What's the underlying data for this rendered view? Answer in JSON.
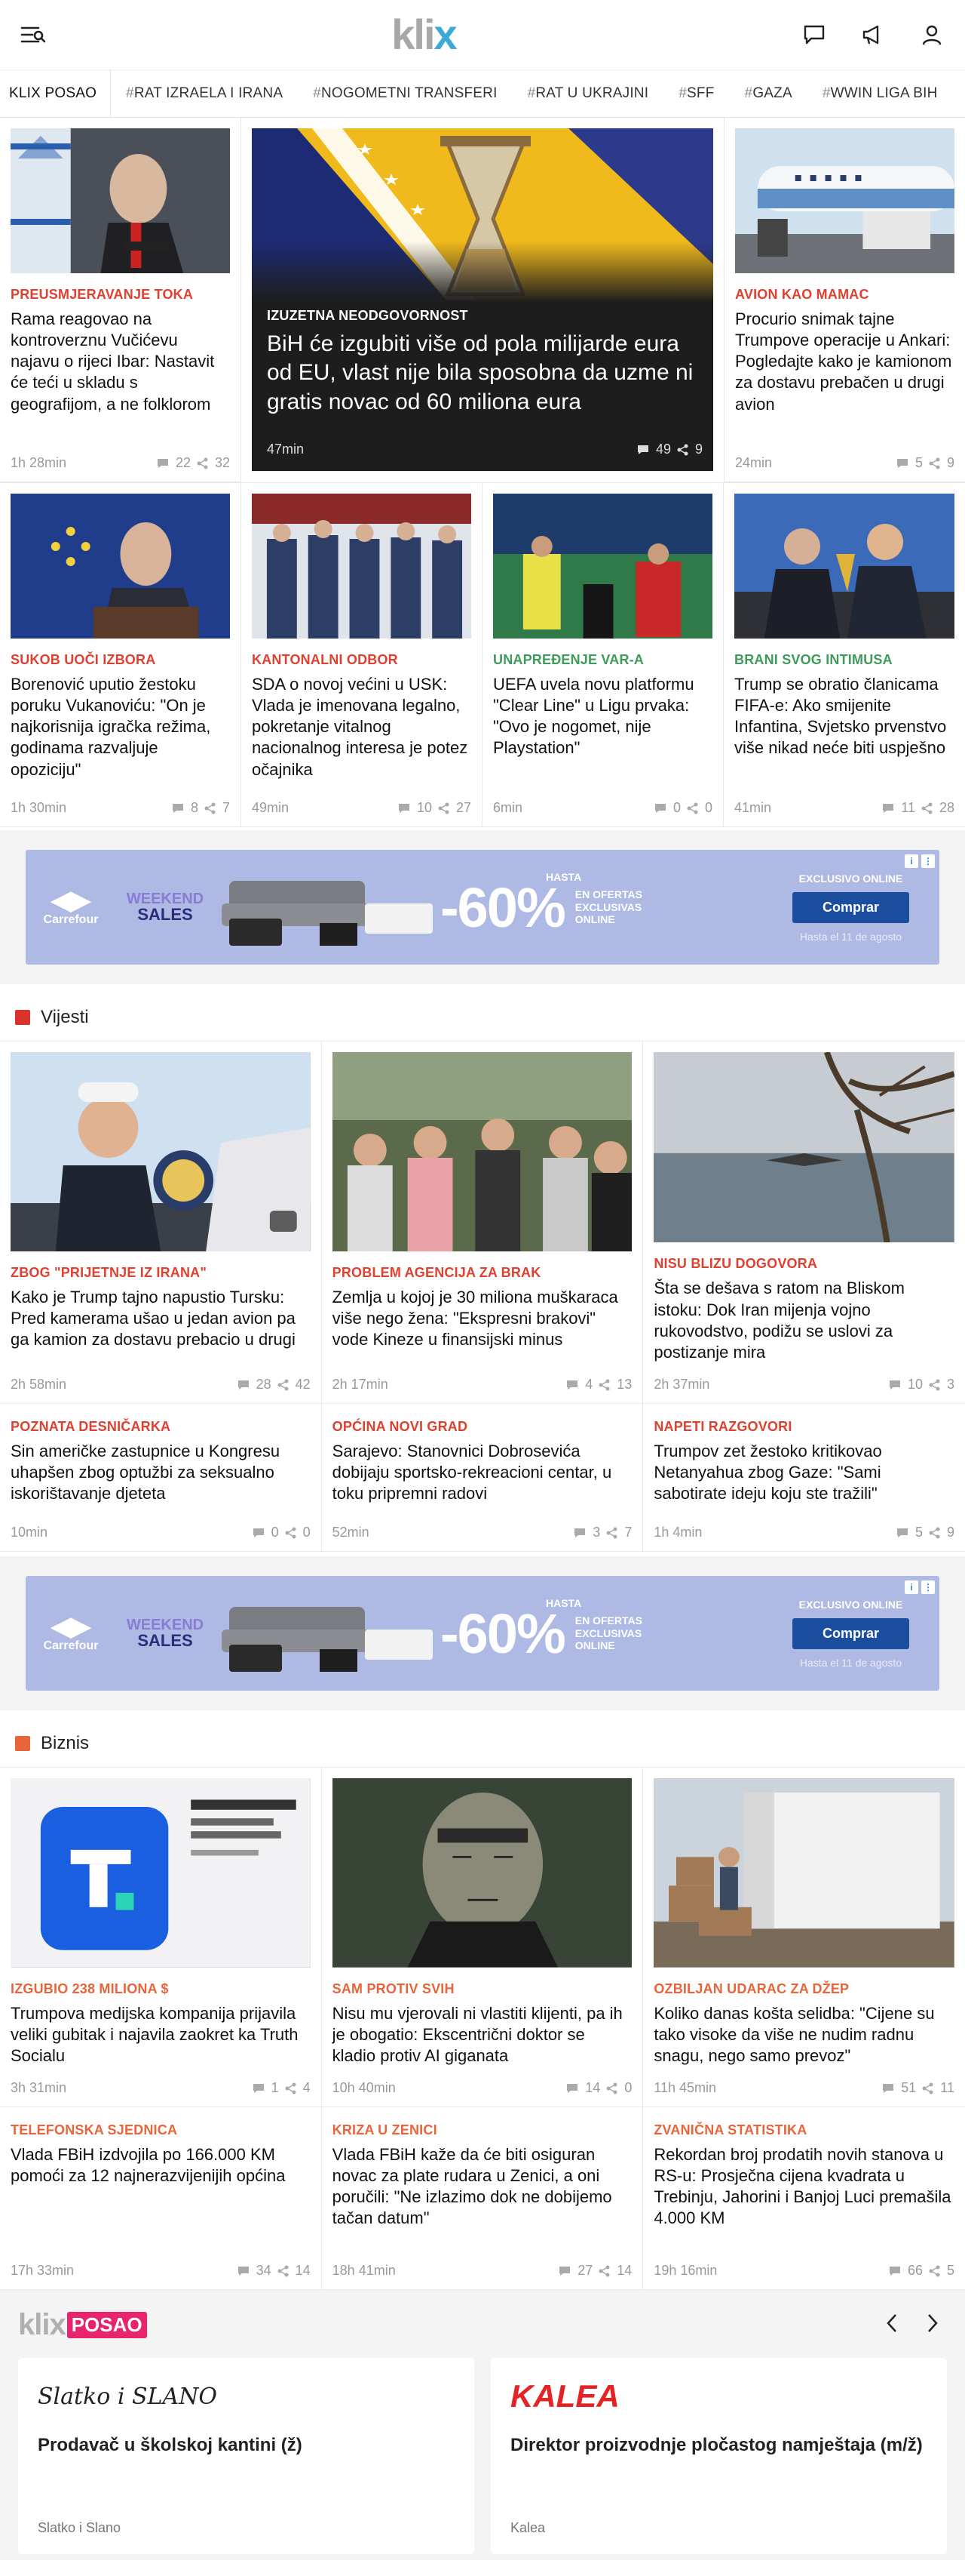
{
  "header": {
    "logo": {
      "pre": "kli",
      "x": "x"
    },
    "icons": [
      "menu-icon",
      "chat-icon",
      "megaphone-icon",
      "user-icon"
    ]
  },
  "tags": [
    {
      "label": "KLIX POSAO",
      "hash": ""
    },
    {
      "label": "RAT IZRAELA I IRANA",
      "hash": "#"
    },
    {
      "label": "NOGOMETNI TRANSFERI",
      "hash": "#"
    },
    {
      "label": "RAT U UKRAJINI",
      "hash": "#"
    },
    {
      "label": "SFF",
      "hash": "#"
    },
    {
      "label": "GAZA",
      "hash": "#"
    },
    {
      "label": "WWIN LIGA BIH",
      "hash": "#"
    }
  ],
  "top": {
    "left": {
      "kicker": "PREUSMJERAVANJE TOKA",
      "title": "Rama reagovao na kontroverznu Vučićevu najavu o rijeci Ibar: Nastavit će teći u skladu s geografijom, a ne folklorom",
      "time": "1h 28min",
      "comments": "22",
      "shares": "32"
    },
    "featured": {
      "kicker": "IZUZETNA NEODGOVORNOST",
      "title": "BiH će izgubiti više od pola milijarde eura od EU, vlast nije bila sposobna da uzme ni gratis novac od 60 miliona eura",
      "time": "47min",
      "comments": "49",
      "shares": "9"
    },
    "right": {
      "kicker": "AVION KAO MAMAC",
      "title": "Procurio snimak tajne Trumpove operacije u Ankari: Pogledajte kako je kamionom za dostavu prebačen u drugi avion",
      "time": "24min",
      "comments": "5",
      "shares": "9"
    }
  },
  "row2": [
    {
      "kicker": "SUKOB UOČI IZBORA",
      "color": "red",
      "title": "Borenović uputio žestoku poruku Vukanoviću: \"On je najkorisnija igračka režima, godinama razvaljuje opoziciju\"",
      "time": "1h 30min",
      "comments": "8",
      "shares": "7"
    },
    {
      "kicker": "KANTONALNI ODBOR",
      "color": "red",
      "title": "SDA o novoj većini u USK: Vlada je imenovana legalno, pokretanje vitalnog nacionalnog interesa je potez očajnika",
      "time": "49min",
      "comments": "10",
      "shares": "27"
    },
    {
      "kicker": "UNAPREĐENJE VAR-A",
      "color": "green",
      "title": "UEFA uvela novu platformu \"Clear Line\" u Ligu prvaka: \"Ovo je nogomet, nije Playstation\"",
      "time": "6min",
      "comments": "0",
      "shares": "0"
    },
    {
      "kicker": "BRANI SVOG INTIMUSA",
      "color": "green",
      "title": "Trump se obratio članicama FIFA-e: Ako smijenite Infantina, Svjetsko prvenstvo više nikad neće biti uspješno",
      "time": "41min",
      "comments": "11",
      "shares": "28"
    }
  ],
  "ad": {
    "brand": "Carrefour",
    "weekend": "WEEKEND",
    "sales": "SALES",
    "hasta": "HASTA",
    "percent": "-60%",
    "ofertas": "EN OFERTAS EXCLUSIVAS ONLINE",
    "exclusivo": "EXCLUSIVO ONLINE",
    "button": "Comprar",
    "until": "Hasta el 11 de agosto"
  },
  "vijesti": {
    "title": "Vijesti",
    "color": "#d9342b",
    "items": [
      {
        "kicker": "ZBOG \"PRIJETNJE IZ IRANA\"",
        "title": "Kako je Trump tajno napustio Tursku: Pred kamerama ušao u jedan avion pa ga kamion za dostavu prebacio u drugi",
        "time": "2h 58min",
        "comments": "28",
        "shares": "42"
      },
      {
        "kicker": "PROBLEM AGENCIJA ZA BRAK",
        "title": "Zemlja u kojoj je 30 miliona muškaraca više nego žena: \"Ekspresni brakovi\" vode Kineze u finansijski minus",
        "time": "2h 17min",
        "comments": "4",
        "shares": "13"
      },
      {
        "kicker": "NISU BLIZU DOGOVORA",
        "title": "Šta se dešava s ratom na Bliskom istoku: Dok Iran mijenja vojno rukovodstvo, podižu se uslovi za postizanje mira",
        "time": "2h 37min",
        "comments": "10",
        "shares": "3"
      },
      {
        "kicker": "POZNATA DESNIČARKA",
        "title": "Sin američke zastupnice u Kongresu uhapšen zbog optužbi za seksualno iskorištavanje djeteta",
        "time": "10min",
        "comments": "0",
        "shares": "0"
      },
      {
        "kicker": "OPĆINA NOVI GRAD",
        "title": "Sarajevo: Stanovnici Dobrosevića dobijaju sportsko-rekreacioni centar, u toku pripremni radovi",
        "time": "52min",
        "comments": "3",
        "shares": "7"
      },
      {
        "kicker": "NAPETI RAZGOVORI",
        "title": "Trumpov zet žestoko kritikovao Netanyahua zbog Gaze: \"Sami sabotirate ideju koju ste tražili\"",
        "time": "1h 4min",
        "comments": "5",
        "shares": "9"
      }
    ]
  },
  "biznis": {
    "title": "Biznis",
    "color": "#e8643a",
    "items": [
      {
        "kicker": "IZGUBIO 238 MILIONA $",
        "title": "Trumpova medijska kompanija prijavila veliki gubitak i najavila zaokret ka Truth Socialu",
        "time": "3h 31min",
        "comments": "1",
        "shares": "4"
      },
      {
        "kicker": "SAM PROTIV SVIH",
        "title": "Nisu mu vjerovali ni vlastiti klijenti, pa ih je obogatio: Ekscentrični doktor se kladio protiv AI giganata",
        "time": "10h 40min",
        "comments": "14",
        "shares": "0"
      },
      {
        "kicker": "OZBILJAN UDARAC ZA DŽEP",
        "title": "Koliko danas košta selidba: \"Cijene su tako visoke da više ne nudim radnu snagu, nego samo prevoz\"",
        "time": "11h 45min",
        "comments": "51",
        "shares": "11"
      },
      {
        "kicker": "TELEFONSKA SJEDNICA",
        "title": "Vlada FBiH izdvojila po 166.000 KM pomoći za 12 najnerazvijenijih općina",
        "time": "17h 33min",
        "comments": "34",
        "shares": "14"
      },
      {
        "kicker": "KRIZA U ZENICI",
        "title": "Vlada FBiH kaže da će biti osiguran novac za plate rudara u Zenici, a oni poručili: \"Ne izlazimo dok ne dobijemo tačan datum\"",
        "time": "18h 41min",
        "comments": "27",
        "shares": "14"
      },
      {
        "kicker": "ZVANIČNA STATISTIKA",
        "title": "Rekordan broj prodatih novih stanova u RS-u: Prosječna cijena kvadrata u Trebinju, Jahorini i Banjoj Luci premašila 4.000 KM",
        "time": "19h 16min",
        "comments": "66",
        "shares": "5"
      }
    ]
  },
  "posao": {
    "klix": "klix",
    "badge": "POSAO",
    "jobs": [
      {
        "logo": "Slatko i SLANO",
        "title": "Prodavač u školskoj kantini (ž)",
        "company": "Slatko i Slano"
      },
      {
        "logo": "KALEA",
        "title": "Direktor proizvodnje pločastog namještaja (m/ž)",
        "company": "Kalea"
      }
    ]
  },
  "colors": {
    "red": "#e0402f",
    "green": "#3e9b5a",
    "orange": "#e8643a",
    "featured_bg": "#1d1d1d",
    "ad_bg": "#aeb9e4",
    "posao_badge": "#e8246e"
  }
}
